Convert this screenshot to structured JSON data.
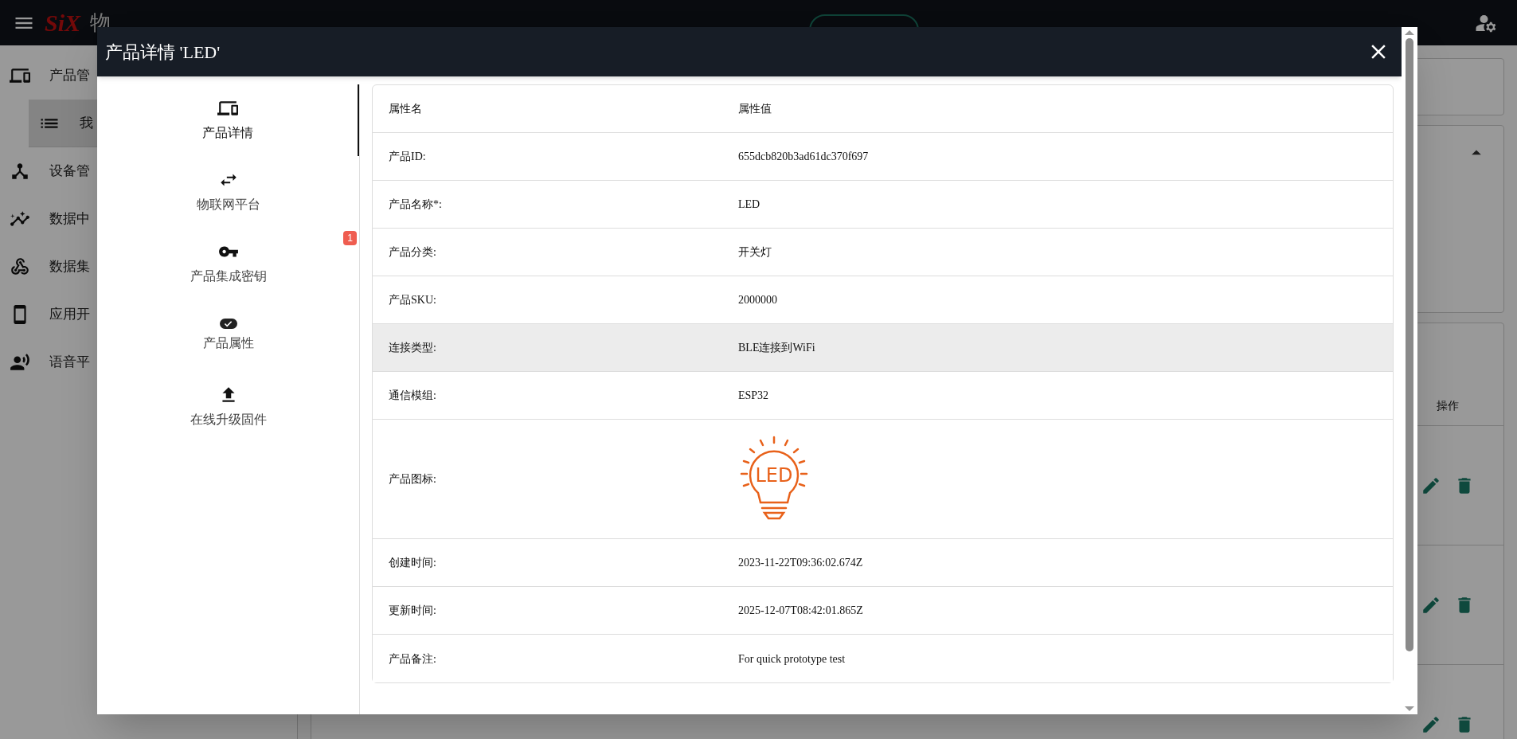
{
  "header": {
    "logo": "SiX",
    "title": "物"
  },
  "sidebar": {
    "items": [
      {
        "label": "产品管",
        "selected": false,
        "children": [
          {
            "label": "我",
            "selected": true
          }
        ]
      },
      {
        "label": "设备管",
        "selected": false
      },
      {
        "label": "数据中",
        "selected": false
      },
      {
        "label": "数据集",
        "selected": false
      },
      {
        "label": "应用开",
        "selected": false
      },
      {
        "label": "语音平",
        "selected": false
      }
    ]
  },
  "background_table": {
    "action_header": "操作"
  },
  "dialog": {
    "title": "产品详情 'LED'",
    "nav": [
      {
        "label": "产品详情",
        "selected": true
      },
      {
        "label": "物联网平台",
        "selected": false
      },
      {
        "label": "产品集成密钥",
        "selected": false,
        "badge": "1"
      },
      {
        "label": "产品属性",
        "selected": false
      },
      {
        "label": "在线升级固件",
        "selected": false
      }
    ],
    "table": {
      "columns": [
        "属性名",
        "属性值"
      ],
      "rows": [
        {
          "kind": "text",
          "label": "产品ID:",
          "value": "655dcb820b3ad61dc370f697",
          "hovered": false
        },
        {
          "kind": "text",
          "label": "产品名称*:",
          "value": "LED",
          "hovered": false
        },
        {
          "kind": "text",
          "label": "产品分类:",
          "value": "开关灯",
          "hovered": false
        },
        {
          "kind": "text",
          "label": "产品SKU:",
          "value": "2000000",
          "hovered": false
        },
        {
          "kind": "text",
          "label": "连接类型:",
          "value": "BLE连接到WiFi",
          "hovered": true
        },
        {
          "kind": "text",
          "label": "通信模组:",
          "value": "ESP32",
          "hovered": false
        },
        {
          "kind": "image",
          "label": "产品图标:",
          "image_text": "LED",
          "hovered": false
        },
        {
          "kind": "text",
          "label": "创建时间:",
          "value": "2023-11-22T09:36:02.674Z",
          "hovered": false
        },
        {
          "kind": "text",
          "label": "更新时间:",
          "value": "2025-12-07T08:42:01.865Z",
          "hovered": false
        },
        {
          "kind": "text",
          "label": "产品备注:",
          "value": "For quick prototype test",
          "hovered": false
        }
      ]
    }
  }
}
